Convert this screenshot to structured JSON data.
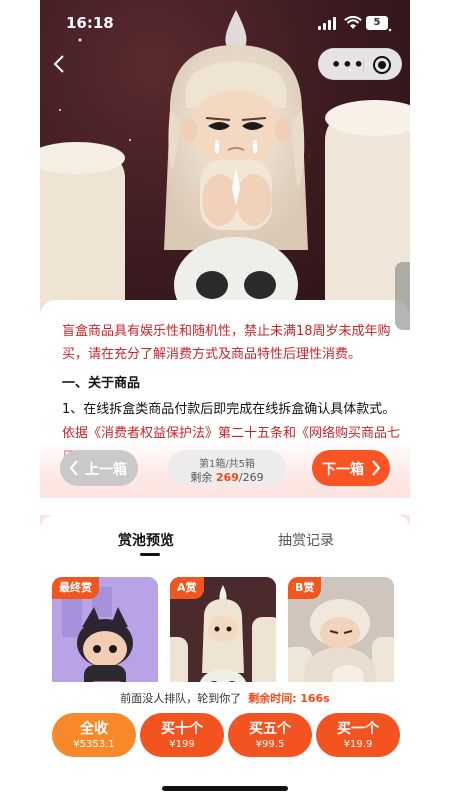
{
  "status_bar": {
    "time": "16:18",
    "battery": "5"
  },
  "header": {
    "back_icon": "chevron-left-icon",
    "menu_icon": "more-dots-icon",
    "close_icon": "target-icon"
  },
  "notice": {
    "warning": "盲盒商品具有娱乐性和随机性，禁止未满18周岁未成年购买，请在充分了解消费方式及商品特性后理性消费。",
    "section_title": "一、关于商品",
    "item_1_plain": "1、在线拆盒类商品付款后即完成在线拆盒确认具体款式。",
    "item_1_red": "依据《消费者权益保护法》第二十五条和《网络购买商品七日无理"
  },
  "box_nav": {
    "prev_label": "上一箱",
    "next_label": "下一箱",
    "box_index": "第1箱/共5箱",
    "remaining_label": "剩余",
    "remaining_count": "269",
    "remaining_total": "/269"
  },
  "tabs": [
    {
      "label": "赏池预览",
      "active": true
    },
    {
      "label": "抽赏记录",
      "active": false
    }
  ],
  "prize_cards": [
    {
      "tag": "最终赏"
    },
    {
      "tag": "A赏"
    },
    {
      "tag": "B赏"
    }
  ],
  "queue": {
    "message": "前面没人排队，轮到你了",
    "timer_label": "剩余时间:",
    "timer_value": "166s"
  },
  "buy_buttons": [
    {
      "label": "全收",
      "price": "¥5353.1"
    },
    {
      "label": "买十个",
      "price": "¥199"
    },
    {
      "label": "买五个",
      "price": "¥99.5"
    },
    {
      "label": "买一个",
      "price": "¥19.9"
    }
  ],
  "colors": {
    "accent_orange": "#f35321",
    "light_orange": "#f7892a",
    "warning_red": "#c9242a",
    "pink_bg": "#fde3df",
    "disabled_grey": "#c9c9c9"
  }
}
